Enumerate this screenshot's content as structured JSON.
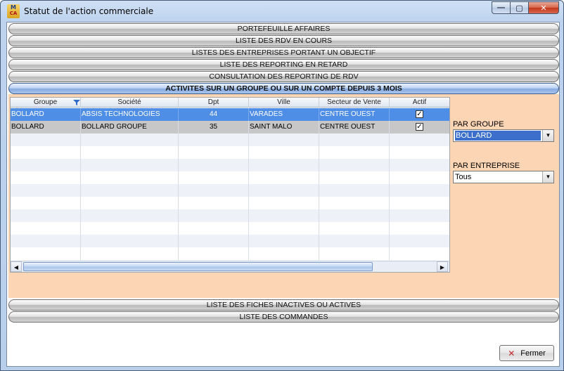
{
  "window": {
    "title": "Statut de l'action commerciale",
    "icon_top": "M",
    "icon_bottom": "CA",
    "minimize_glyph": "—",
    "maximize_glyph": "▢",
    "close_glyph": "✕"
  },
  "sections": [
    {
      "label": "PORTEFEUILLE AFFAIRES",
      "active": false
    },
    {
      "label": "LISTE DES RDV EN COURS",
      "active": false
    },
    {
      "label": "LISTES DES ENTREPRISES PORTANT UN OBJECTIF",
      "active": false
    },
    {
      "label": "LISTE DES REPORTING EN RETARD",
      "active": false
    },
    {
      "label": "CONSULTATION DES REPORTING DE RDV",
      "active": false
    },
    {
      "label": "ACTIVITES SUR UN GROUPE OU SUR UN COMPTE DEPUIS 3 MOIS",
      "active": true
    },
    {
      "label": "LISTE DES FICHES INACTIVES OU ACTIVES",
      "active": false
    },
    {
      "label": "LISTE DES COMMANDES",
      "active": false
    }
  ],
  "grid": {
    "columns": [
      "Groupe",
      "Société",
      "Dpt",
      "Ville",
      "Secteur de Vente",
      "Actif"
    ],
    "rows": [
      {
        "groupe": "BOLLARD",
        "societe": "ABSIS TECHNOLOGIES",
        "dpt": "44",
        "ville": "VARADES",
        "secteur": "CENTRE OUEST",
        "actif": "✓"
      },
      {
        "groupe": "BOLLARD",
        "societe": "BOLLARD GROUPE",
        "dpt": "35",
        "ville": "SAINT MALO",
        "secteur": "CENTRE OUEST",
        "actif": "✓"
      }
    ],
    "scroll_left": "◀",
    "scroll_right": "▶"
  },
  "filters": {
    "groupe_label": "PAR GROUPE",
    "groupe_value": "BOLLARD",
    "entreprise_label": "PAR ENTREPRISE",
    "entreprise_value": "Tous",
    "dropdown_glyph": "▼"
  },
  "footer": {
    "close_label": "Fermer",
    "close_icon": "✕"
  },
  "colors": {
    "panel_bg": "#fcd5b4",
    "selected_row": "#4f8ee6",
    "close_button": "#c4361a"
  }
}
